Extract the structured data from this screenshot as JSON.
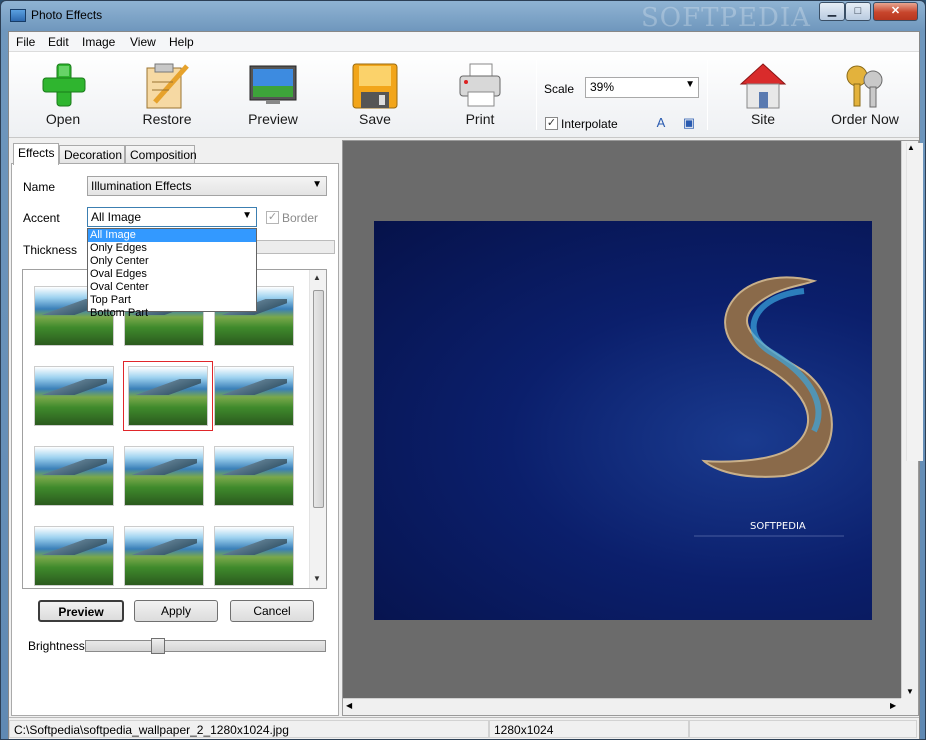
{
  "window": {
    "title": "Photo Effects",
    "watermark": "SOFTPEDIA"
  },
  "menu": [
    "File",
    "Edit",
    "Image",
    "View",
    "Help"
  ],
  "toolbar": {
    "open": "Open",
    "restore": "Restore",
    "preview": "Preview",
    "save": "Save",
    "print": "Print",
    "scale_label": "Scale",
    "scale_value": "39%",
    "interpolate": "Interpolate",
    "site": "Site",
    "order_now": "Order Now"
  },
  "tabs": [
    "Effects",
    "Decoration",
    "Composition"
  ],
  "effects": {
    "name_label": "Name",
    "name_value": "Illumination Effects",
    "accent_label": "Accent",
    "accent_value": "All Image",
    "border_label": "Border",
    "thickness_label": "Thickness",
    "accent_options": [
      "All Image",
      "Only Edges",
      "Only Center",
      "Oval Edges",
      "Oval Center",
      "Top Part",
      "Bottom Part"
    ],
    "preview_btn": "Preview",
    "apply_btn": "Apply",
    "cancel_btn": "Cancel",
    "brightness_label": "Brightness",
    "brightness_level": 0.29
  },
  "image_text": {
    "brand": "SOFTPEDIA"
  },
  "status": {
    "path": "C:\\Softpedia\\softpedia_wallpaper_2_1280x1024.jpg",
    "size": "1280x1024"
  },
  "colors": {
    "accent_highlight": "#3399ff",
    "selection_frame": "#e0262a",
    "canvas_bg": "#6b6b6b"
  },
  "icons": [
    "open-plus-icon",
    "restore-icon",
    "preview-icon",
    "save-floppy-icon",
    "print-icon",
    "site-house-icon",
    "order-keys-icon"
  ]
}
